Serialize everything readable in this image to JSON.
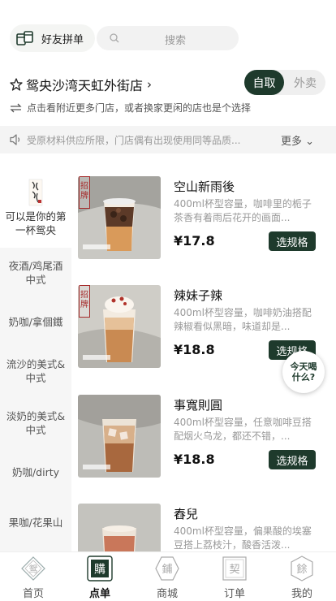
{
  "header": {
    "group_order_label": "好友拼单",
    "search_placeholder": "搜索"
  },
  "store": {
    "name": "鸳央沙湾天虹外街店",
    "mode_pickup": "自取",
    "mode_delivery": "外卖",
    "hint": "点击看附近更多门店，或者换家更闲的店也是个选择"
  },
  "notice": {
    "text": "受原材料供应所限，门店偶有出现使用同等品质...",
    "more": "更多"
  },
  "sidebar": {
    "items": [
      {
        "label": "可以是你的第一杯鸳央"
      },
      {
        "label": "夜酒/鸡尾酒中式"
      },
      {
        "label": "奶咖/拿個鐵"
      },
      {
        "label": "流沙的美式&中式"
      },
      {
        "label": "淡奶的美式&中式"
      },
      {
        "label": "奶咖/dirty"
      },
      {
        "label": "果咖/花果山"
      }
    ]
  },
  "products": [
    {
      "name": "空山新雨後",
      "desc": "400ml杯型容量，咖啡里的栀子茶香有着雨后花开的画面...",
      "price": "¥17.8",
      "button": "选规格",
      "badge": "招牌"
    },
    {
      "name": "辣妹子辣",
      "desc": "400ml杯型容量，咖啡奶油搭配辣椒看似黑暗，味道却是...",
      "price": "¥18.8",
      "button": "选规格",
      "badge": "招牌"
    },
    {
      "name": "事寬則圓",
      "desc": "400ml杯型容量，任意咖啡豆搭配烟火乌龙，都还不错，...",
      "price": "¥18.8",
      "button": "选规格",
      "badge": ""
    },
    {
      "name": "舂兒",
      "desc": "400ml杯型容量，偏果酸的埃塞豆搭上荔枝汁，酸香活泼...",
      "price": "",
      "button": "",
      "badge": ""
    }
  ],
  "floating": {
    "label": "今天喝什么?"
  },
  "tabbar": {
    "items": [
      {
        "label": "首页",
        "glyph": "鸳"
      },
      {
        "label": "点单",
        "glyph": "購"
      },
      {
        "label": "商城",
        "glyph": "鋪"
      },
      {
        "label": "订单",
        "glyph": "契"
      },
      {
        "label": "我的",
        "glyph": "餘"
      }
    ]
  },
  "colors": {
    "accent": "#1e3a2c",
    "badge": "#a52a2a"
  }
}
